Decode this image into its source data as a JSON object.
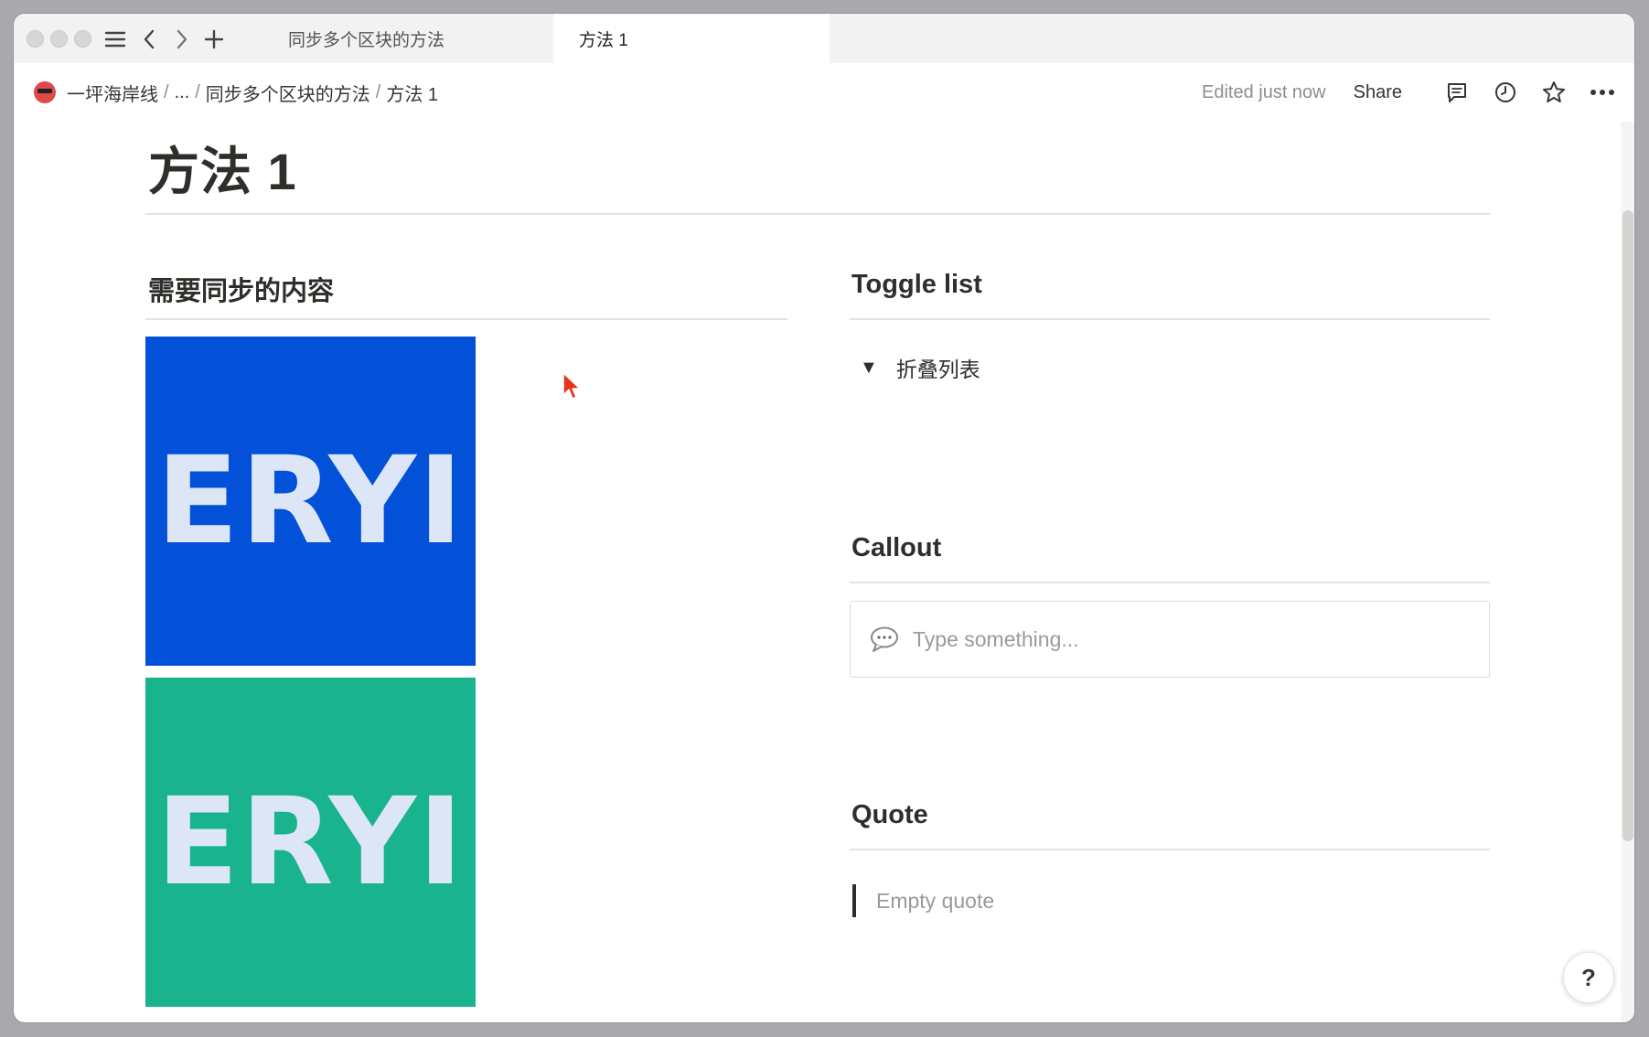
{
  "tabs": [
    {
      "label": "同步多个区块的方法",
      "active": false
    },
    {
      "label": "方法 1",
      "active": true
    }
  ],
  "breadcrumb": {
    "workspace": "一坪海岸线",
    "ellipsis": "...",
    "parent": "同步多个区块的方法",
    "current": "方法 1",
    "separator": "/"
  },
  "topbar": {
    "edited": "Edited just now",
    "share": "Share",
    "icons": [
      "comment-icon",
      "history-icon",
      "star-icon",
      "more-icon"
    ]
  },
  "page": {
    "title": "方法 1",
    "left_column": {
      "heading": "需要同步的内容",
      "images": [
        {
          "text": "ERYI",
          "background": "#0350d9"
        },
        {
          "text": "ERYI",
          "background": "#19b38d"
        }
      ]
    },
    "right_column": {
      "toggle_heading": "Toggle list",
      "toggle_item": "折叠列表",
      "callout_heading": "Callout",
      "callout_placeholder": "Type something...",
      "quote_heading": "Quote",
      "quote_placeholder": "Empty quote"
    }
  },
  "help_label": "?",
  "colors": {
    "accent_blue": "#0350d9",
    "accent_green": "#19b38d",
    "text": "#37352f",
    "muted": "#9b9a97"
  }
}
